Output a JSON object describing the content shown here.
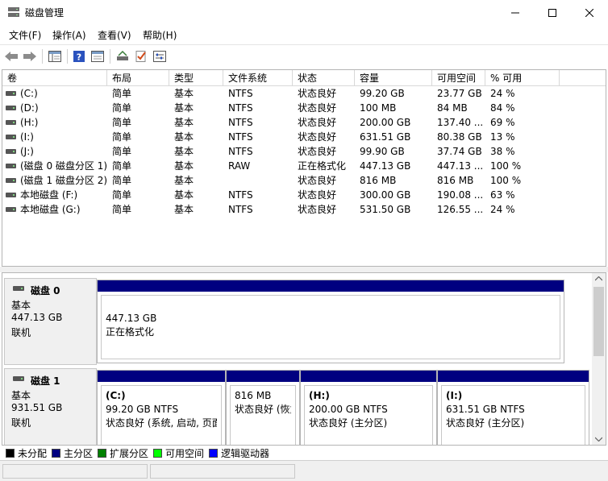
{
  "window": {
    "title": "磁盘管理"
  },
  "menu": [
    "文件(F)",
    "操作(A)",
    "查看(V)",
    "帮助(H)"
  ],
  "toolbar": {
    "icons": [
      "back-arrow-icon",
      "forward-arrow-icon",
      "properties-icon",
      "help-icon",
      "show-hide-console-tree-icon",
      "connect-drive-icon",
      "check-icon",
      "settings-icon"
    ]
  },
  "volume_list": {
    "columns": [
      "卷",
      "布局",
      "类型",
      "文件系统",
      "状态",
      "容量",
      "可用空间",
      "% 可用"
    ],
    "rows": [
      [
        "(C:)",
        "简单",
        "基本",
        "NTFS",
        "状态良好",
        "99.20 GB",
        "23.77 GB",
        "24 %"
      ],
      [
        "(D:)",
        "简单",
        "基本",
        "NTFS",
        "状态良好",
        "100 MB",
        "84 MB",
        "84 %"
      ],
      [
        "(H:)",
        "简单",
        "基本",
        "NTFS",
        "状态良好",
        "200.00 GB",
        "137.40 ...",
        "69 %"
      ],
      [
        "(I:)",
        "简单",
        "基本",
        "NTFS",
        "状态良好",
        "631.51 GB",
        "80.38 GB",
        "13 %"
      ],
      [
        "(J:)",
        "简单",
        "基本",
        "NTFS",
        "状态良好",
        "99.90 GB",
        "37.74 GB",
        "38 %"
      ],
      [
        "(磁盘 0 磁盘分区 1)",
        "简单",
        "基本",
        "RAW",
        "正在格式化",
        "447.13 GB",
        "447.13 ...",
        "100 %"
      ],
      [
        "(磁盘 1 磁盘分区 2)",
        "简单",
        "基本",
        "",
        "状态良好",
        "816 MB",
        "816 MB",
        "100 %"
      ],
      [
        "本地磁盘 (F:)",
        "简单",
        "基本",
        "NTFS",
        "状态良好",
        "300.00 GB",
        "190.08 ...",
        "63 %"
      ],
      [
        "本地磁盘 (G:)",
        "简单",
        "基本",
        "NTFS",
        "状态良好",
        "531.50 GB",
        "126.55 ...",
        "24 %"
      ]
    ]
  },
  "disks": [
    {
      "name": "磁盘 0",
      "type": "基本",
      "size": "447.13 GB",
      "state": "联机",
      "partitions": [
        {
          "name": "",
          "size": "447.13 GB",
          "status": "正在格式化"
        }
      ]
    },
    {
      "name": "磁盘 1",
      "type": "基本",
      "size": "931.51 GB",
      "state": "联机",
      "partitions": [
        {
          "name": "(C:)",
          "size": "99.20 GB NTFS",
          "status": "状态良好 (系统, 启动, 页面"
        },
        {
          "name": "",
          "size": "816 MB",
          "status": "状态良好 (恢复"
        },
        {
          "name": "(H:)",
          "size": "200.00 GB NTFS",
          "status": "状态良好 (主分区)"
        },
        {
          "name": "(I:)",
          "size": "631.51 GB NTFS",
          "status": "状态良好 (主分区)"
        }
      ]
    }
  ],
  "legend": [
    {
      "label": "未分配",
      "color": "#000000"
    },
    {
      "label": "主分区",
      "color": "#000080"
    },
    {
      "label": "扩展分区",
      "color": "#008000"
    },
    {
      "label": "可用空间",
      "color": "#00ff00"
    },
    {
      "label": "逻辑驱动器",
      "color": "#0000ff"
    }
  ]
}
